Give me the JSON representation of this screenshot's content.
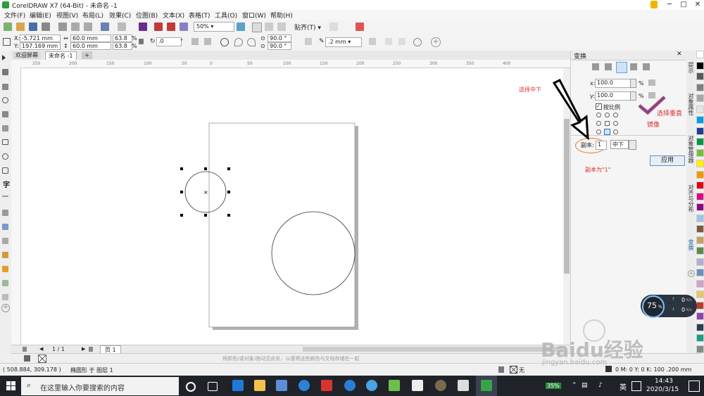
{
  "window": {
    "title": "CorelDRAW X7 (64-Bit) - 未命名 -1",
    "min": "─",
    "max": "□",
    "close": "✕"
  },
  "menu": [
    "文件(F)",
    "编辑(E)",
    "视图(V)",
    "布局(L)",
    "效果(C)",
    "位图(B)",
    "文本(X)",
    "表格(T)",
    "工具(O)",
    "窗口(W)",
    "帮助(H)"
  ],
  "toolbar": {
    "zoom": "50%",
    "snap": "贴齐(T)"
  },
  "props": {
    "x": "-5.721 mm",
    "y": "197.169 mm",
    "w": "60.0 mm",
    "h": "60.0 mm",
    "sx": "63.8",
    "sy": "63.8",
    "pct": "%",
    "rot": ".0",
    "deg": "°",
    "a1": "90.0 °",
    "a2": "90.0 °",
    "outline": ".2 mm"
  },
  "tabs": {
    "welcome": "欢迎屏幕",
    "doc": "未命名 -1",
    "add": "+"
  },
  "ruler": [
    "250",
    "200",
    "150",
    "100",
    "50",
    "0",
    "50",
    "100",
    "150",
    "200",
    "250",
    "300",
    "350",
    "400"
  ],
  "docker": {
    "title": "变换",
    "xlabel": "x:",
    "x": "100.0",
    "ylabel": "y:",
    "y": "100.0",
    "pct": "%",
    "proportional": "按比例",
    "copies_label": "副本:",
    "copies": "1",
    "anchor": "中下",
    "apply": "应用",
    "note1": "选择中下",
    "note2": "选择垂直",
    "note3": "镜像",
    "note4": "副本为\"1\""
  },
  "docker_tabs": [
    "提示",
    "对象属性",
    "对象管理器",
    "对齐与分布",
    "变换"
  ],
  "palette": [
    "#ffffff",
    "#000000",
    "#595959",
    "#7f7f7f",
    "#a6a6a6",
    "#e5e5e5",
    "#00a0e9",
    "#1e3f96",
    "#009944",
    "#7cbb3a",
    "#fff100",
    "#f39800",
    "#e60012",
    "#e4007f",
    "#920783",
    "#a3c3e6",
    "#7a5b3c",
    "#c9a063",
    "#5b8b4a",
    "#b0b0d0",
    "#6a8fc0",
    "#d2a2c8",
    "#e9c46a",
    "#c0392b",
    "#8e44ad",
    "#2c3e50",
    "#16a085",
    "#7f8c8d"
  ],
  "pager": {
    "pages": "1 / 1",
    "page": "页 1"
  },
  "hint": "将颜色(或对象)拖动至此处，以便将这些颜色与文档存储在一起",
  "status": {
    "coords": "( 508.884, 309.178 )",
    "obj": "椭圆形 于 图层 1",
    "fill": "无",
    "outline": "0 M: 0 Y: 0 K: 100  .200 mm",
    "o1": "0"
  },
  "gauge": {
    "percent": "75",
    "unit": "%",
    "up": "0",
    "down": "0",
    "speed_unit": "K/s"
  },
  "watermark": {
    "main": "Baidu经验",
    "sub": "jingyan.baidu.com"
  },
  "taskbar": {
    "search": "在这里输入你要搜索的内容",
    "battery": "35%",
    "ime": "英",
    "time": "14:43",
    "date": "2020/3/15"
  }
}
